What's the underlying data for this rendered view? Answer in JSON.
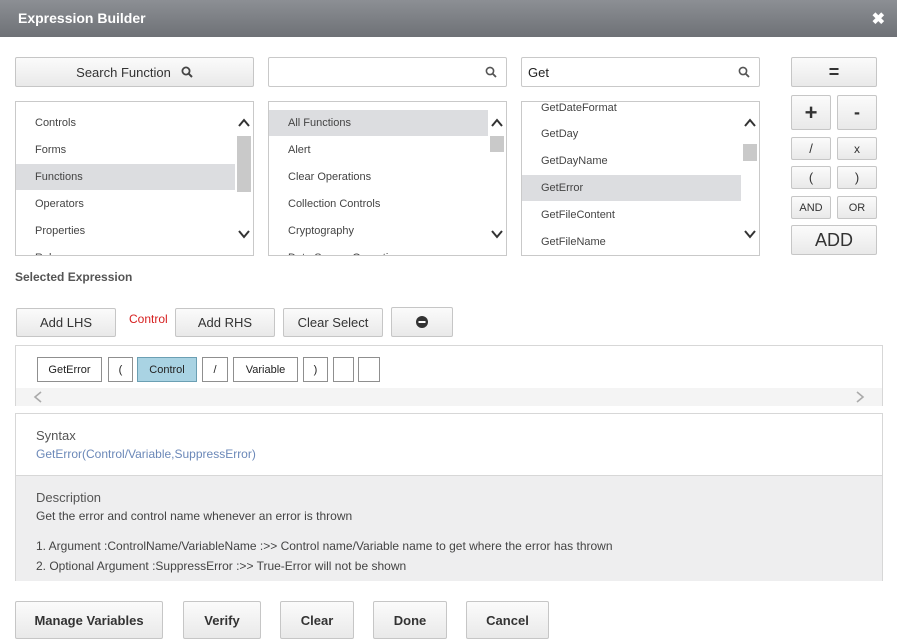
{
  "window": {
    "title": "Expression Builder",
    "close_glyph": "✖"
  },
  "top": {
    "search_function_label": "Search Function",
    "search_mid_value": "",
    "search_right_value": "Get"
  },
  "operators": {
    "equals": "=",
    "plus": "+",
    "minus": "-",
    "divide": "/",
    "multiply": "x",
    "open_paren": "(",
    "close_paren": ")",
    "and": "AND",
    "or": "OR",
    "add": "ADD"
  },
  "categories": [
    "Controls",
    "Forms",
    "Functions",
    "Operators",
    "Properties",
    "Rules"
  ],
  "function_groups": [
    "All Functions",
    "Alert",
    "Clear Operations",
    "Collection Controls",
    "Cryptography",
    "Data Source Operations"
  ],
  "functions": [
    "GetDateFormat",
    "GetDay",
    "GetDayName",
    "GetError",
    "GetFileContent",
    "GetFileName"
  ],
  "selected_expression": {
    "label": "Selected Expression",
    "add_lhs": "Add LHS",
    "control_tag": "Control",
    "add_rhs": "Add RHS",
    "clear_select": "Clear Select",
    "tokens": [
      "GetError",
      "(",
      "Control",
      "/",
      "Variable",
      ")",
      "",
      ""
    ]
  },
  "syntax": {
    "heading": "Syntax",
    "text": "GetError(Control/Variable,SuppressError)"
  },
  "description": {
    "heading": "Description",
    "text": "Get the error and control name whenever an error is thrown",
    "arg1": "1. Argument :ControlName/VariableName :>> Control name/Variable name to get where the error has thrown",
    "arg2": "2. Optional Argument :SuppressError :>> True-Error will not be shown"
  },
  "footer": {
    "manage_variables": "Manage Variables",
    "verify": "Verify",
    "clear": "Clear",
    "done": "Done",
    "cancel": "Cancel"
  },
  "colors": {
    "titlebar": "#7b7e83",
    "selected_row": "#dcdde0",
    "selected_token": "#a9d3e3",
    "control_tag": "#d62020",
    "syntax_text": "#6b88b8"
  },
  "icons": [
    "search-icon",
    "close-icon",
    "minus-circle-icon",
    "scroll-up-icon",
    "scroll-down-icon",
    "scroll-left-icon",
    "scroll-right-icon"
  ]
}
